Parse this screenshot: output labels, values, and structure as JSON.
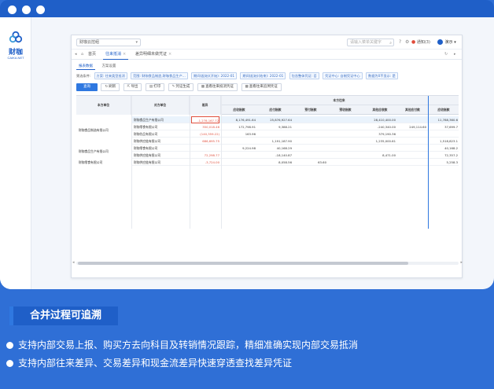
{
  "colors": {
    "brand": "#1f5fc8",
    "accent": "#2f78e0",
    "negative": "#e0503e",
    "background": "#2f6fd6"
  },
  "brand": {
    "logo_text": "财咖",
    "logo_sub": "CAIKA.NET"
  },
  "header": {
    "org_select": "财咖云控组",
    "search_placeholder": "请输入菜单关键字",
    "notice_label": "通知(3)",
    "user_label": "演示"
  },
  "tabs": [
    {
      "label": "首页",
      "active": false
    },
    {
      "label": "往来抵消",
      "active": true
    },
    {
      "label": "差异明细未做凭证",
      "active": false
    }
  ],
  "subtabs": [
    {
      "label": "报表数据",
      "active": true
    },
    {
      "label": "方案设置",
      "active": false
    }
  ],
  "filter": {
    "label": "筛选条件:",
    "chips": [
      "方案: 往来类型抵消",
      "范围: 财咖食品制造,财咖食品生产...",
      "期间(起始)(开始): 2022-01",
      "期间(起始)(结束): 2022-01",
      "包含整体凭证: 否",
      "凭证中心: 自制凭证中心",
      "数据为0不显示: 是"
    ]
  },
  "toolbar": {
    "query": "查询",
    "refresh": "刷新",
    "export": "导出",
    "print": "打印",
    "make_voucher": "凭证生成",
    "view_internal": "查看往来抵消凭证",
    "view_trace": "查看往来追溯凭证"
  },
  "table": {
    "headers": {
      "self_unit": "本方单位",
      "counter_unit": "对方单位",
      "diff": "差异",
      "self_group": "本方往来",
      "ar": "应收账款",
      "ap": "应付账款",
      "prepay": "预付账款",
      "prerecv": "预收账款",
      "other_recv": "其他应收款",
      "other_pay": "其他应付款",
      "last": "应收账款"
    },
    "groups": [
      {
        "name": "财咖食品制造有限公司",
        "row_start": 0,
        "rows": 4
      },
      {
        "name": "财咖食品生产有限公司",
        "row_start": 4,
        "rows": 2
      },
      {
        "name": "财咖零食有限公司",
        "row_start": 6,
        "rows": 1
      }
    ],
    "rows": [
      {
        "counter": "财咖食品生产有限公司",
        "diff": "-1,278,167.72",
        "c1": "8,176,491.64",
        "c2": "25,876,927.64",
        "c3": "",
        "c4": "",
        "c5": "28,410,400.00",
        "c6": "",
        "c7": "11,788,360.6",
        "hl": true,
        "boxed": true
      },
      {
        "counter": "财咖零食有限公司",
        "diff": "350,018.46",
        "c1": "172,798.91",
        "c2": "9,388.21",
        "c3": "",
        "c4": "",
        "c5": "-240,340.00",
        "c6": "249,114.60",
        "c7": "37,699.7",
        "hl": false,
        "boxed": false
      },
      {
        "counter": "财咖饮品有限公司",
        "diff": "(140,359.22)",
        "c1": "163.96",
        "c2": "",
        "c3": "",
        "c4": "",
        "c5": "379,190.36",
        "c6": "",
        "c7": "",
        "hl": false,
        "boxed": false
      },
      {
        "counter": "财咖供应链有限公司",
        "diff": "686,695.75",
        "c1": "",
        "c2": "1,191,187.90",
        "c3": "",
        "c4": "",
        "c5": "1,235,000.61",
        "c6": "",
        "c7": "1,518,823.1",
        "hl": false,
        "boxed": false
      },
      {
        "counter": "财咖零食有限公司",
        "diff": "",
        "c1": "9,224.98",
        "c2": "40,168.29",
        "c3": "",
        "c4": "",
        "c5": "",
        "c6": "",
        "c7": "40,168.2",
        "hl": false,
        "boxed": false
      },
      {
        "counter": "财咖供应链有限公司",
        "diff": "72,298.77",
        "c1": "",
        "c2": "-18,140.87",
        "c3": "",
        "c4": "",
        "c5": "8,471.00",
        "c6": "",
        "c7": "72,357.2",
        "hl": false,
        "boxed": false
      },
      {
        "counter": "财咖供应链有限公司",
        "diff": "-3,724.00",
        "c1": "",
        "c2": "8,058.56",
        "c3": "63.60",
        "c4": "",
        "c5": "",
        "c6": "",
        "c7": "5,258.3",
        "hl": false,
        "boxed": false
      }
    ]
  },
  "feature": {
    "title": "合并过程可追溯",
    "bullets": [
      "支持内部交易上报、购买方去向科目及转销情况跟踪，精细准确实现内部交易抵消",
      "支持内部往来差异、交易差异和现金流差异快速穿透查找差异凭证"
    ]
  }
}
